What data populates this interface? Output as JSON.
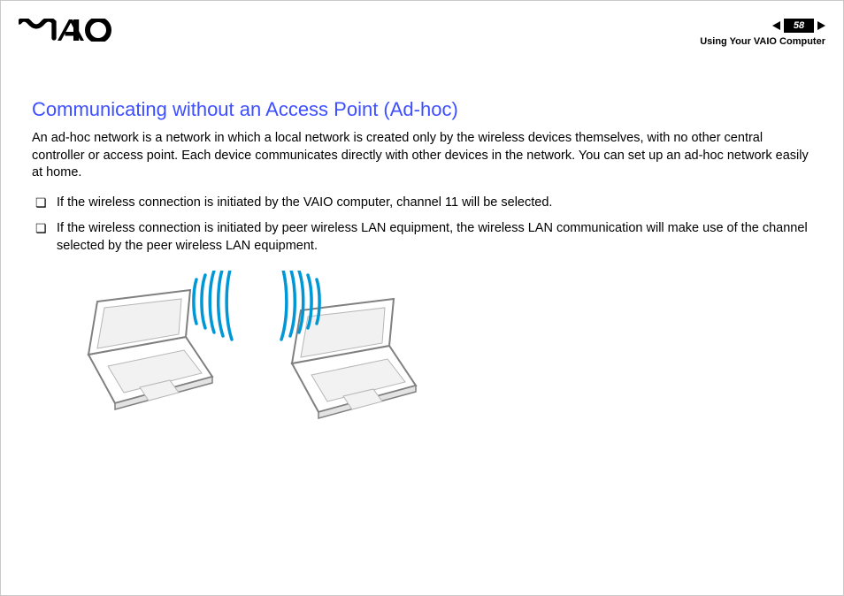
{
  "header": {
    "logo_name": "vaio-logo",
    "page_number": "58",
    "section": "Using Your VAIO Computer"
  },
  "content": {
    "title": "Communicating without an Access Point (Ad-hoc)",
    "intro": "An ad-hoc network is a network in which a local network is created only by the wireless devices themselves, with no other central controller or access point. Each device communicates directly with other devices in the network. You can set up an ad-hoc network easily at home.",
    "bullets": [
      "If the wireless connection is initiated by the VAIO computer, channel 11 will be selected.",
      "If the wireless connection is initiated by peer wireless LAN equipment, the wireless LAN communication will make use of the channel selected by the peer wireless LAN equipment."
    ],
    "diagram_alt": "Two laptops communicating directly via wireless signal"
  }
}
